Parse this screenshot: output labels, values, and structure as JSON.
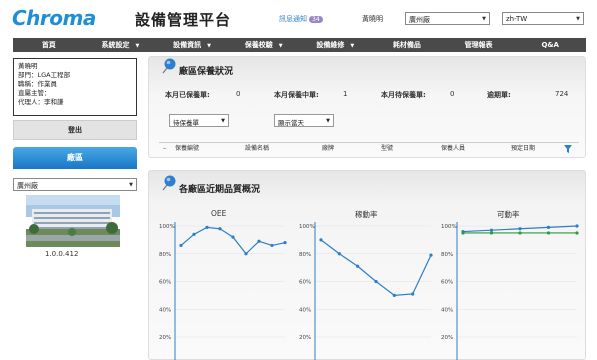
{
  "header": {
    "logo": "Chroma",
    "title": "設備管理平台",
    "notify_label": "訊息通知",
    "notify_count": "34",
    "user": "黃曉明",
    "site": "廣州廠",
    "lang": "zh-TW"
  },
  "nav": [
    "首頁",
    "系統設定",
    "設備資訊",
    "保養校驗",
    "設備維修",
    "耗材備品",
    "管理報表",
    "Q&A"
  ],
  "nav_dropdown": [
    false,
    true,
    true,
    true,
    true,
    false,
    false,
    false
  ],
  "user_box": {
    "name": "黃曉明",
    "dept": "部門：LGA工程部",
    "role": "職稱：作業員",
    "manager": "直屬主管：",
    "agent": "代理人：李和謙"
  },
  "logout": "登出",
  "site_header": "廠區",
  "site_select": "廣州廠",
  "version": "1.0.0.412",
  "maint": {
    "title": "廠區保養狀況",
    "done_label": "本月已保養單:",
    "done": "0",
    "inprog_label": "本月保養中單:",
    "inprog": "1",
    "pending_label": "本月待保養單:",
    "pending": "0",
    "overdue_label": "逾期單:",
    "overdue": "724",
    "filter1": "待保養單",
    "filter2": "顯示當天",
    "columns": [
      "保養編號",
      "設備名稱",
      "廠牌",
      "型號",
      "保養人員",
      "預定日期"
    ]
  },
  "quality": {
    "title": "各廠區近期品質概況"
  },
  "chart_data": [
    {
      "type": "line",
      "title": "OEE",
      "y_ticks": [
        "100%",
        "80%",
        "60%",
        "40%",
        "20%"
      ],
      "ylim": [
        0,
        100
      ],
      "series": [
        {
          "values": [
            86,
            94,
            99,
            98,
            92,
            80,
            89,
            86,
            88
          ]
        }
      ],
      "color": "#2a7fc9"
    },
    {
      "type": "line",
      "title": "稼動率",
      "y_ticks": [
        "100%",
        "80%",
        "60%",
        "40%",
        "20%"
      ],
      "ylim": [
        0,
        100
      ],
      "series": [
        {
          "values": [
            90,
            80,
            71,
            60,
            50,
            51,
            79
          ]
        }
      ],
      "color": "#2a7fc9"
    },
    {
      "type": "line",
      "title": "可動率",
      "y_ticks": [
        "100%",
        "80%",
        "60%",
        "40%",
        "20%"
      ],
      "ylim": [
        0,
        100
      ],
      "series": [
        {
          "values": [
            96,
            97,
            98,
            99,
            100
          ]
        },
        {
          "values": [
            95,
            95,
            95,
            95,
            95
          ]
        }
      ],
      "colors": [
        "#2a7fc9",
        "#2b9a3a"
      ]
    }
  ]
}
